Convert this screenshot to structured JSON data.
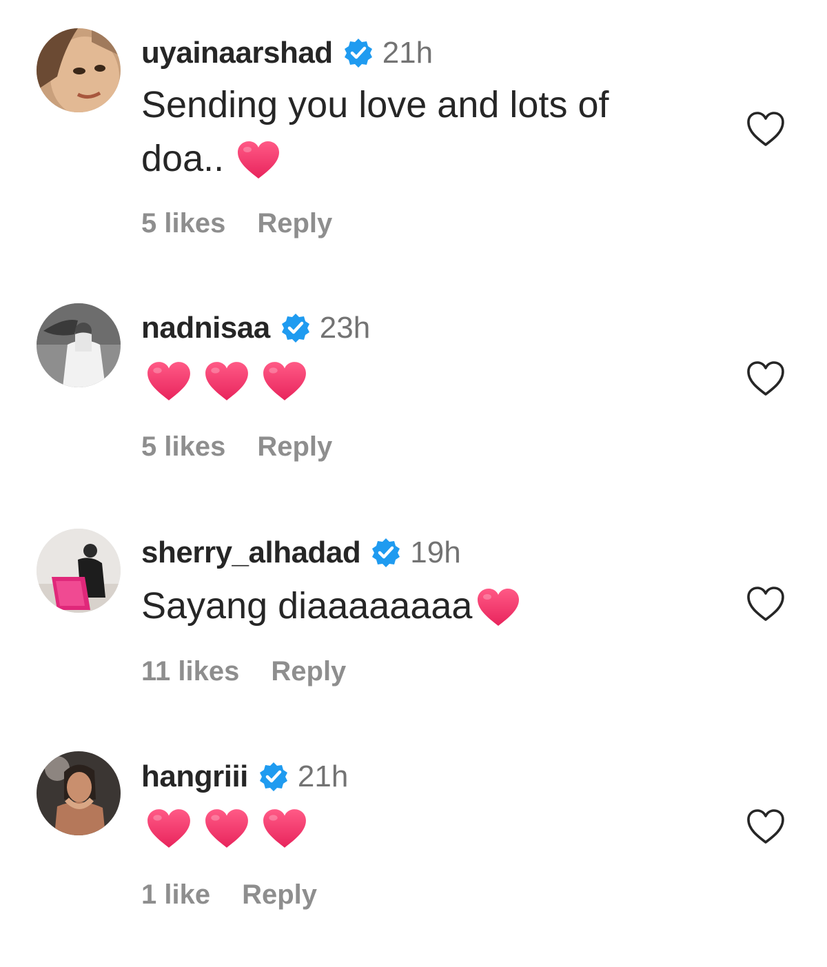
{
  "colors": {
    "verified_badge": "#1f9bf0",
    "heart_emoji": "#f0326a",
    "meta_text": "#8e8e8e",
    "time_text": "#737373",
    "username_text": "#262626"
  },
  "comments": [
    {
      "username": "uyainaarshad",
      "verified": true,
      "time": "21h",
      "text_line1": "Sending you love and lots of",
      "text_line2": "doa..",
      "emoji": "red-heart",
      "likes": "5 likes",
      "reply": "Reply",
      "like_icon": "heart-outline-icon"
    },
    {
      "username": "nadnisaa",
      "verified": true,
      "time": "23h",
      "emojis": [
        "red-heart",
        "red-heart",
        "red-heart"
      ],
      "likes": "5 likes",
      "reply": "Reply",
      "like_icon": "heart-outline-icon"
    },
    {
      "username": "sherry_alhadad",
      "verified": true,
      "time": "19h",
      "text": "Sayang diaaaaaaaa",
      "emoji": "red-heart",
      "likes": "11 likes",
      "reply": "Reply",
      "like_icon": "heart-outline-icon"
    },
    {
      "username": "hangriii",
      "verified": true,
      "time": "21h",
      "emojis": [
        "red-heart",
        "red-heart",
        "red-heart"
      ],
      "likes": "1 like",
      "reply": "Reply",
      "like_icon": "heart-outline-icon"
    }
  ]
}
